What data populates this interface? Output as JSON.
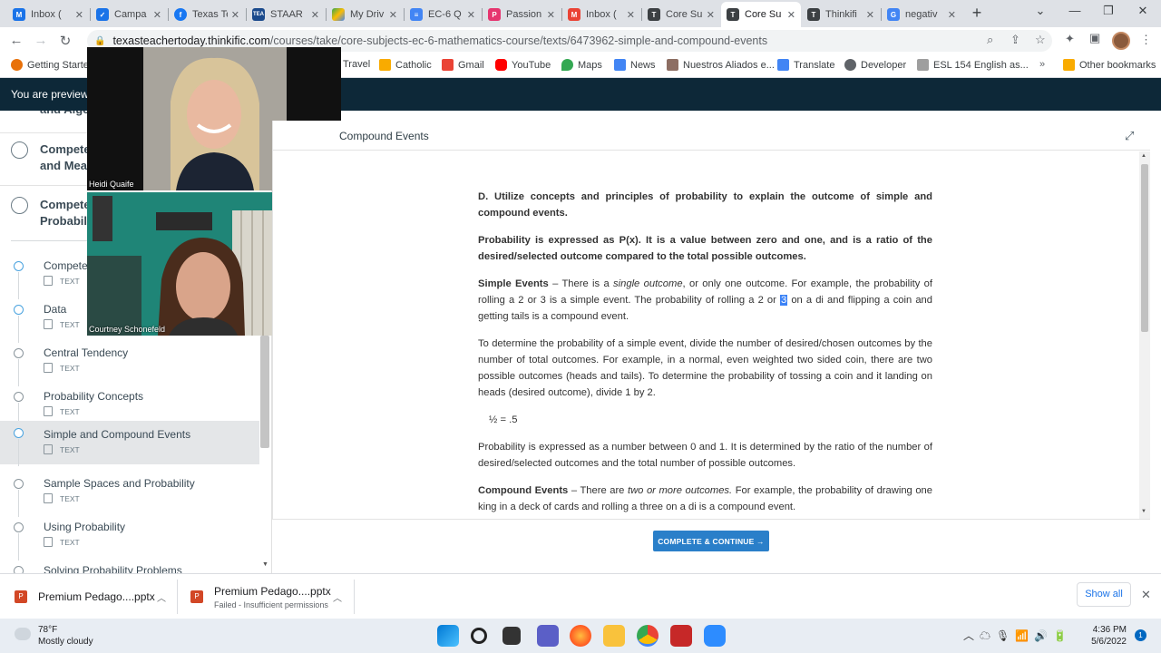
{
  "tabs": [
    {
      "title": "Inbox (",
      "fav": "#1a73e8"
    },
    {
      "title": "Campa",
      "fav": "#1a73e8"
    },
    {
      "title": "Texas Te",
      "fav": "#1877f2"
    },
    {
      "title": "STAAR",
      "fav": "#1b4a8c"
    },
    {
      "title": "My Driv",
      "fav": "#34a853"
    },
    {
      "title": "EC-6 Q",
      "fav": "#4285f4"
    },
    {
      "title": "Passion",
      "fav": "#e6356f"
    },
    {
      "title": "Inbox (",
      "fav": "#ea4335"
    },
    {
      "title": "Core Su",
      "fav": "#3c4043"
    },
    {
      "title": "Core Su",
      "fav": "#3c4043"
    },
    {
      "title": "Thinkifi",
      "fav": "#3c4043"
    },
    {
      "title": "negativ",
      "fav": "#4285f4"
    }
  ],
  "address": {
    "host": "texasteachertoday.thinkific.com",
    "path": "/courses/take/core-subjects-ec-6-mathematics-course/texts/6473962-simple-and-compound-events"
  },
  "bookmarks": [
    {
      "label": "Getting Started",
      "color": "#e8710a"
    },
    {
      "label": "Travel",
      "color": "#f9ab00"
    },
    {
      "label": "Catholic",
      "color": "#f9ab00"
    },
    {
      "label": "Gmail",
      "color": "#ea4335"
    },
    {
      "label": "YouTube",
      "color": "#ff0000"
    },
    {
      "label": "Maps",
      "color": "#34a853"
    },
    {
      "label": "News",
      "color": "#4285f4"
    },
    {
      "label": "Nuestros Aliados e...",
      "color": "#8d6e63"
    },
    {
      "label": "Translate",
      "color": "#4285f4"
    },
    {
      "label": "Developer",
      "color": "#5f6368"
    },
    {
      "label": "ESL 154 English as...",
      "color": "#9e9e9e"
    },
    {
      "label": "Other bookmarks",
      "color": "#f9ab00"
    }
  ],
  "preview_banner": "You are previewing",
  "sidebar": {
    "chapters": [
      {
        "line1": "",
        "line2": "and Alge"
      },
      {
        "line1": "Compete",
        "line2": "and Meas"
      },
      {
        "line1": "Compete",
        "line2": "Probabili"
      }
    ],
    "items": [
      {
        "name": "Competer",
        "type": "TEXT"
      },
      {
        "name": "Data",
        "type": "TEXT"
      },
      {
        "name": "Central Tendency",
        "type": "TEXT"
      },
      {
        "name": "Probability Concepts",
        "type": "TEXT"
      },
      {
        "name": "Simple and Compound Events",
        "type": "TEXT"
      },
      {
        "name": "Sample Spaces and Probability",
        "type": "TEXT"
      },
      {
        "name": "Using Probability",
        "type": "TEXT"
      },
      {
        "name": "Solving Probability Problems",
        "type": ""
      }
    ]
  },
  "video": {
    "person1": "Heidi Quaife",
    "person2": "Courtney Schonefeld"
  },
  "content": {
    "title": "Compound Events",
    "p1": "D. Utilize concepts and principles of probability to explain the outcome of simple and compound events.",
    "p2": "Probability is expressed as P(x).  It is a value between zero and one, and is a ratio of the desired/selected outcome compared to the total possible outcomes.",
    "p3_head": "Simple Events",
    "p3_a": " – There is a ",
    "p3_em": "single outcome",
    "p3_b": ", or only one outcome.  For example, the probability of rolling a 2 or 3 is a simple event.  The probability of rolling a 2 or ",
    "p3_hl": "3",
    "p3_c": " on a di and flipping a coin and getting tails is a compound event.",
    "p4": "To determine the probability of a simple event, divide the number of desired/chosen outcomes by the number of total outcomes. For example, in a normal, even weighted two sided coin, there are two possible outcomes (heads and tails).  To determine the probability of tossing a coin and it landing on heads (desired outcome), divide 1 by 2.",
    "p5": "½ = .5",
    "p6": "Probability is expressed as a number between 0 and 1.  It is determined by the ratio of the number of desired/selected outcomes and the total number of possible outcomes.",
    "p7_head": "Compound Events",
    "p7_a": " – There are ",
    "p7_em": "two or more outcomes.",
    "p7_b": "  For example, the probability of drawing one king in a deck of cards and rolling a three on a di is a compound event.",
    "button": "COMPLETE & CONTINUE →"
  },
  "downloads": {
    "file1": "Premium Pedago....pptx",
    "file2": "Premium Pedago....pptx",
    "file2_status": "Failed - Insufficient permissions",
    "show_all": "Show all"
  },
  "taskbar": {
    "temp": "78°F",
    "weather": "Mostly cloudy",
    "time": "4:36 PM",
    "date": "5/6/2022",
    "notifications": "1"
  }
}
